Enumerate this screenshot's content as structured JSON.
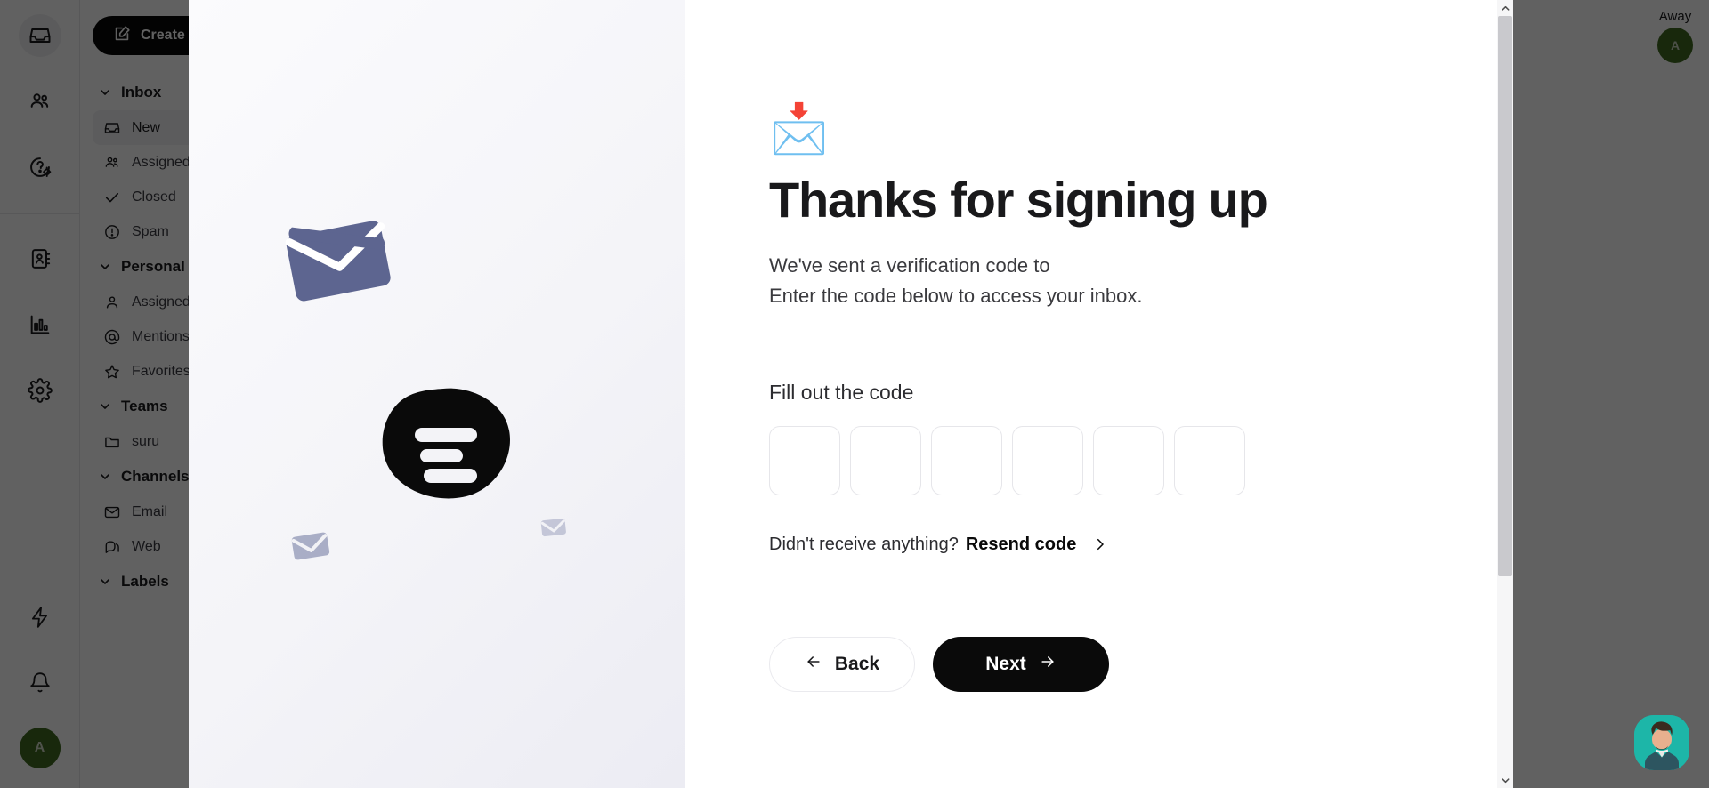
{
  "app": {
    "rail": {
      "items": [
        {
          "name": "inbox-icon",
          "label": "Inbox",
          "active": true
        },
        {
          "name": "contacts-icon",
          "label": "Contacts",
          "active": false
        },
        {
          "name": "help-center-icon",
          "label": "Help Center",
          "active": false
        },
        {
          "name": "address-book-icon",
          "label": "Address Book",
          "active": false
        },
        {
          "name": "reports-icon",
          "label": "Reports",
          "active": false
        },
        {
          "name": "settings-icon",
          "label": "Settings",
          "active": false
        },
        {
          "name": "automations-icon",
          "label": "Automations",
          "active": false
        },
        {
          "name": "notifications-icon",
          "label": "Notifications",
          "active": false
        }
      ],
      "avatar_initial": "A"
    },
    "sidebar": {
      "create_label": "Create",
      "groups": [
        {
          "title": "Inbox",
          "items": [
            {
              "label": "New",
              "icon": "inbox-icon",
              "selected": true
            },
            {
              "label": "Assigned",
              "icon": "users-icon",
              "selected": false
            },
            {
              "label": "Closed",
              "icon": "check-icon",
              "selected": false
            },
            {
              "label": "Spam",
              "icon": "alert-icon",
              "selected": false
            }
          ]
        },
        {
          "title": "Personal",
          "items": [
            {
              "label": "Assigned",
              "icon": "user-icon",
              "selected": false
            },
            {
              "label": "Mentions",
              "icon": "at-icon",
              "selected": false
            },
            {
              "label": "Favorites",
              "icon": "star-icon",
              "selected": false
            }
          ]
        },
        {
          "title": "Teams",
          "items": [
            {
              "label": "suru",
              "icon": "folder-icon",
              "selected": false
            }
          ]
        },
        {
          "title": "Channels",
          "items": [
            {
              "label": "Email",
              "icon": "envelope-icon",
              "selected": false
            },
            {
              "label": "Web",
              "icon": "chat-icon",
              "selected": false
            }
          ]
        },
        {
          "title": "Labels",
          "items": []
        }
      ]
    },
    "status": {
      "label": "Away",
      "avatar_initial": "A"
    }
  },
  "modal": {
    "illustration": {
      "envelope_color": "#5d6590",
      "blob_color": "#0a0a0a",
      "bar_color": "#f3f3f7",
      "small_envelope_color": "#8d93b3"
    },
    "emoji": "📩",
    "title": "Thanks for signing up",
    "subtitle_line1": "We've sent a verification code to",
    "subtitle_line2": "Enter the code below to access your inbox.",
    "code_section_label": "Fill out the code",
    "code_inputs": [
      {
        "value": "",
        "placeholder": ""
      },
      {
        "value": "",
        "placeholder": ""
      },
      {
        "value": "",
        "placeholder": ""
      },
      {
        "value": "",
        "placeholder": ""
      },
      {
        "value": "",
        "placeholder": ""
      },
      {
        "value": "",
        "placeholder": ""
      }
    ],
    "resend_prompt": "Didn't receive anything?",
    "resend_link": "Resend code",
    "back_label": "Back",
    "next_label": "Next"
  },
  "colors": {
    "accent_dark": "#0a0a0a",
    "status_green": "#3f6b20",
    "chat_teal": "#1db6a8",
    "border_light": "#e6e6ea"
  }
}
